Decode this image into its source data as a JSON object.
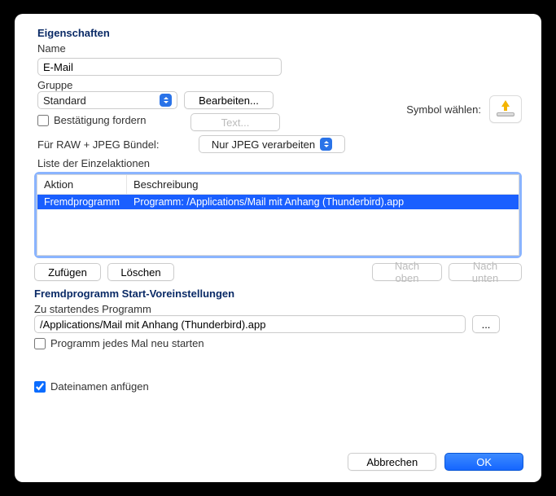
{
  "sections": {
    "properties": "Eigenschaften",
    "foreignProgram": "Fremdprogramm Start-Voreinstellungen"
  },
  "labels": {
    "name": "Name",
    "group": "Gruppe",
    "confirm": "Bestätigung fordern",
    "rawBundle": "Für RAW + JPEG Bündel:",
    "listActions": "Liste der Einzelaktionen",
    "symbolChoose": "Symbol wählen:",
    "programToStart": "Zu startendes Programm",
    "restartEach": "Programm jedes Mal neu starten",
    "appendFilenames": "Dateinamen anfügen"
  },
  "values": {
    "name": "E-Mail",
    "group": "Standard",
    "rawOption": "Nur JPEG verarbeiten",
    "programPath": "/Applications/Mail mit Anhang (Thunderbird).app"
  },
  "buttons": {
    "edit": "Bearbeiten...",
    "textDisabled": "Text...",
    "add": "Zufügen",
    "delete": "Löschen",
    "moveUp": "Nach oben",
    "moveDown": "Nach unten",
    "ellipsis": "...",
    "cancel": "Abbrechen",
    "ok": "OK"
  },
  "table": {
    "headers": {
      "action": "Aktion",
      "desc": "Beschreibung"
    },
    "rows": [
      {
        "action": "Fremdprogramm",
        "desc": "Programm: /Applications/Mail mit Anhang (Thunderbird).app"
      }
    ]
  },
  "checkboxes": {
    "confirm": false,
    "restartEach": false,
    "appendFilenames": true
  }
}
